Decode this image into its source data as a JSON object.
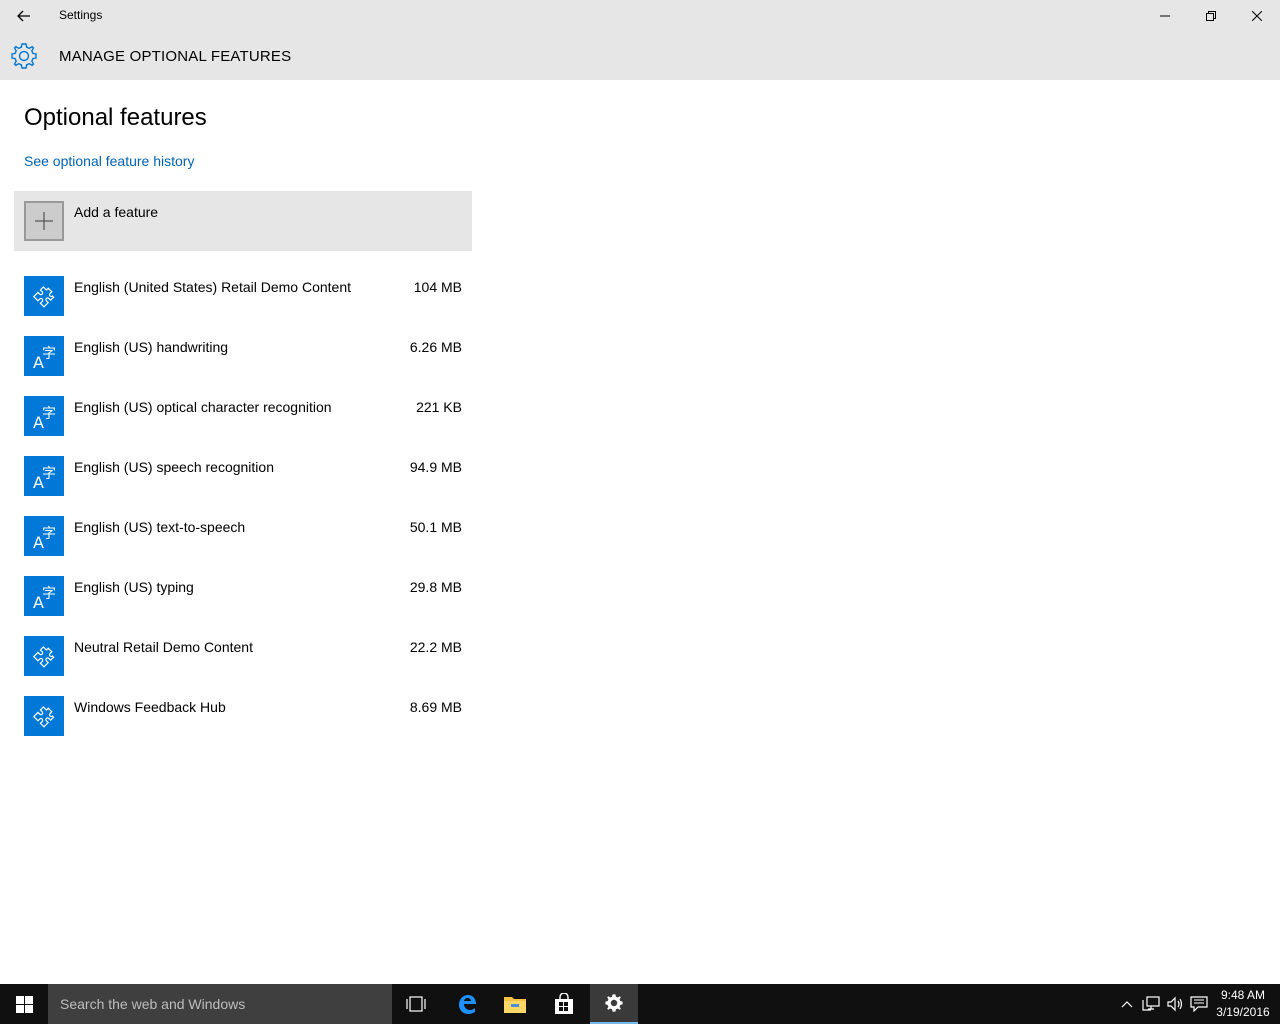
{
  "window": {
    "title": "Settings"
  },
  "header": {
    "title": "MANAGE OPTIONAL FEATURES"
  },
  "main": {
    "title": "Optional features",
    "history_link": "See optional feature history",
    "add_feature": "Add a feature",
    "features": [
      {
        "name": "English (United States) Retail Demo Content",
        "size": "104 MB",
        "icon": "puzzle-icon"
      },
      {
        "name": "English (US) handwriting",
        "size": "6.26 MB",
        "icon": "language-icon"
      },
      {
        "name": "English (US) optical character recognition",
        "size": "221 KB",
        "icon": "language-icon"
      },
      {
        "name": "English (US) speech recognition",
        "size": "94.9 MB",
        "icon": "language-icon"
      },
      {
        "name": "English (US) text-to-speech",
        "size": "50.1 MB",
        "icon": "language-icon"
      },
      {
        "name": "English (US) typing",
        "size": "29.8 MB",
        "icon": "language-icon"
      },
      {
        "name": "Neutral Retail Demo Content",
        "size": "22.2 MB",
        "icon": "puzzle-icon"
      },
      {
        "name": "Windows Feedback Hub",
        "size": "8.69 MB",
        "icon": "puzzle-icon"
      }
    ]
  },
  "taskbar": {
    "search_placeholder": "Search the web and Windows",
    "time": "9:48 AM",
    "date": "3/19/2016",
    "apps": [
      "task-view-icon",
      "edge-icon",
      "file-explorer-icon",
      "store-icon",
      "settings-icon"
    ]
  },
  "colors": {
    "accent": "#0078d7",
    "link": "#0063b1",
    "chrome": "#e6e6e6",
    "taskbar": "#101010"
  }
}
